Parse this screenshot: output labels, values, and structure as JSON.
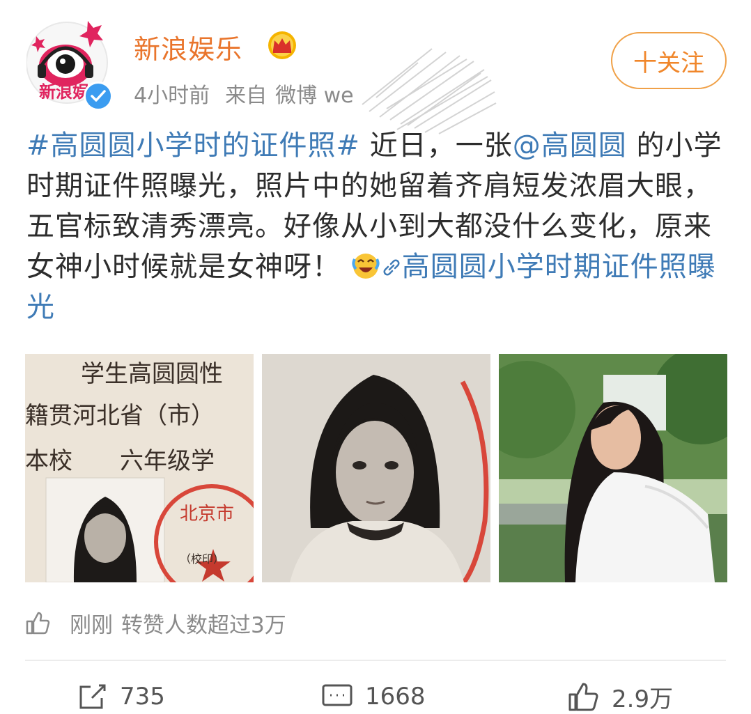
{
  "account": {
    "name": "新浪娱乐",
    "avatar_text": "新浪娱",
    "time": "4小时前",
    "source_prefix": "来自",
    "source": "微博 we"
  },
  "follow_button": "十关注",
  "post": {
    "hashtag": "#高圆圆小学时的证件照#",
    "text1": " 近日，一张",
    "mention": "@高圆圆",
    "text2": " 的小学时期证件照曝光，照片中的她留着齐肩短发浓眉大眼，五官标致清秀漂亮。好像从小到大都没什么变化，原来女神小时候就是女神呀！",
    "link_text": "高圆圆小学时期证件照曝光"
  },
  "photos": {
    "cert_lines": [
      "学生高圆圆性",
      "籍贯河北省（市）",
      "本校　　六年级学",
      "北京市",
      "（校印）"
    ]
  },
  "repost_info": {
    "time": "刚刚",
    "text": "转赞人数超过3万"
  },
  "actions": {
    "share_count": "735",
    "comment_count": "1668",
    "like_count": "2.9万"
  },
  "colors": {
    "username": "#e9752c",
    "link": "#3f7bb6",
    "follow_border": "#f0a148",
    "meta": "#8a8a8a"
  }
}
